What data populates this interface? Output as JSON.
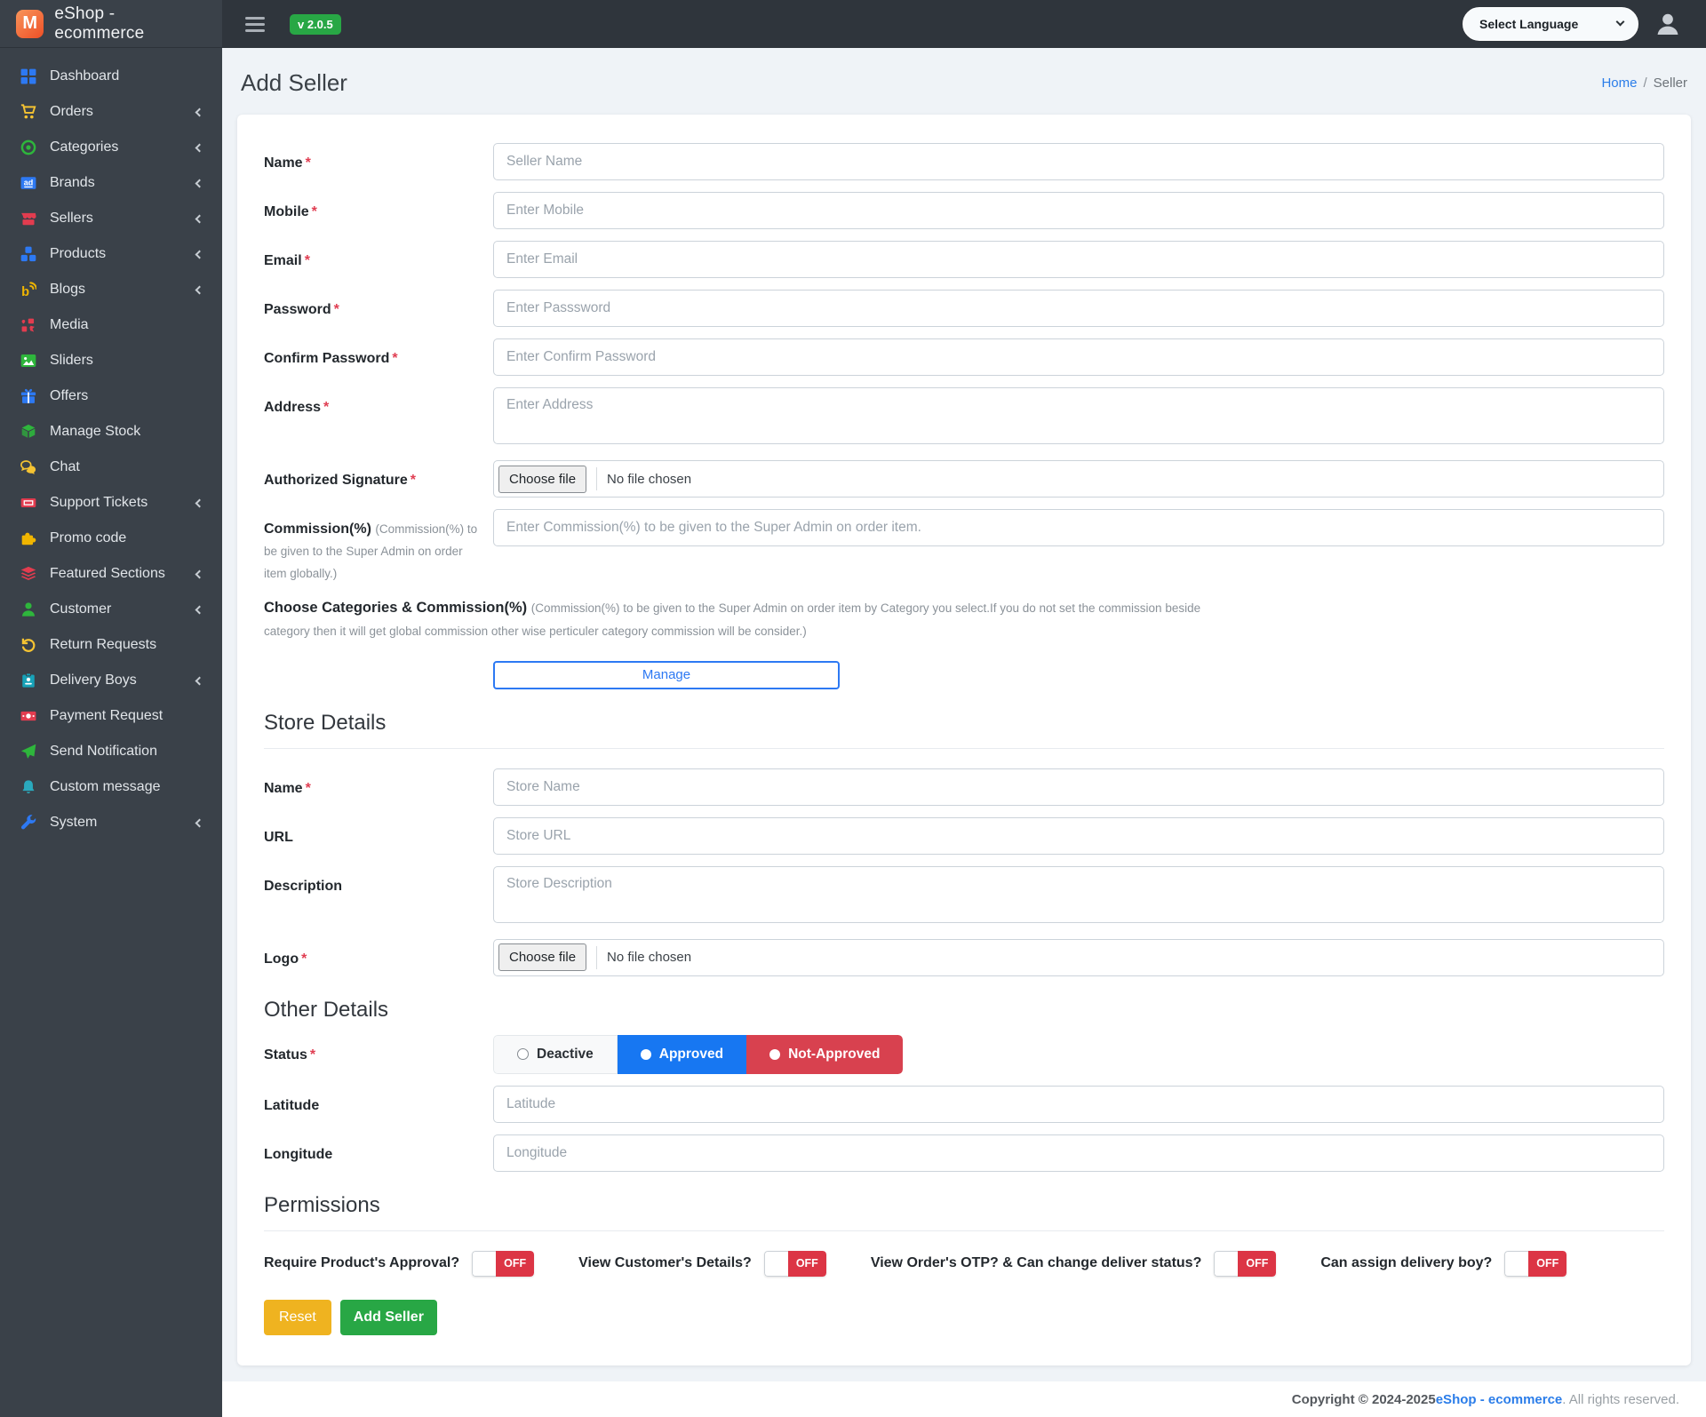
{
  "brand": {
    "logo_letter": "M",
    "title": "eShop - ecommerce",
    "version_badge": "v 2.0.5"
  },
  "navbar": {
    "language_select": "Select Language"
  },
  "sidebar": {
    "items": [
      {
        "label": "Dashboard",
        "icon": "dashboard-grid",
        "has_submenu": false
      },
      {
        "label": "Orders",
        "icon": "cart",
        "has_submenu": true
      },
      {
        "label": "Categories",
        "icon": "target",
        "has_submenu": true
      },
      {
        "label": "Brands",
        "icon": "ad-badge",
        "has_submenu": true
      },
      {
        "label": "Sellers",
        "icon": "storefront",
        "has_submenu": true
      },
      {
        "label": "Products",
        "icon": "cubes",
        "has_submenu": true
      },
      {
        "label": "Blogs",
        "icon": "blog",
        "has_submenu": true
      },
      {
        "label": "Media",
        "icon": "media-cluster",
        "has_submenu": false
      },
      {
        "label": "Sliders",
        "icon": "image",
        "has_submenu": false
      },
      {
        "label": "Offers",
        "icon": "gift",
        "has_submenu": false
      },
      {
        "label": "Manage Stock",
        "icon": "box-3d",
        "has_submenu": false
      },
      {
        "label": "Chat",
        "icon": "chat-bubbles",
        "has_submenu": false
      },
      {
        "label": "Support Tickets",
        "icon": "ticket",
        "has_submenu": true
      },
      {
        "label": "Promo code",
        "icon": "puzzle",
        "has_submenu": false
      },
      {
        "label": "Featured Sections",
        "icon": "layers",
        "has_submenu": true
      },
      {
        "label": "Customer",
        "icon": "person",
        "has_submenu": true
      },
      {
        "label": "Return Requests",
        "icon": "undo-arrow",
        "has_submenu": false
      },
      {
        "label": "Delivery Boys",
        "icon": "id-card",
        "has_submenu": true
      },
      {
        "label": "Payment Request",
        "icon": "banknote",
        "has_submenu": false
      },
      {
        "label": "Send Notification",
        "icon": "paper-plane",
        "has_submenu": false
      },
      {
        "label": "Custom message",
        "icon": "bell",
        "has_submenu": false
      },
      {
        "label": "System",
        "icon": "wrench",
        "has_submenu": true
      }
    ]
  },
  "page": {
    "title": "Add Seller",
    "breadcrumb": {
      "home": "Home",
      "separator": "/",
      "current": "Seller"
    }
  },
  "form": {
    "required_marker": "*",
    "name": {
      "label": "Name",
      "placeholder": "Seller Name"
    },
    "mobile": {
      "label": "Mobile",
      "placeholder": "Enter Mobile"
    },
    "email": {
      "label": "Email",
      "placeholder": "Enter Email"
    },
    "password": {
      "label": "Password",
      "placeholder": "Enter Passsword"
    },
    "confirm_password": {
      "label": "Confirm Password",
      "placeholder": "Enter Confirm Password"
    },
    "address": {
      "label": "Address",
      "placeholder": "Enter Address"
    },
    "authorized_signature": {
      "label": "Authorized Signature",
      "choose_file": "Choose file",
      "no_file": "No file chosen"
    },
    "commission": {
      "label": "Commission(%)",
      "note": "(Commission(%) to be given to the Super Admin on order item globally.)",
      "placeholder": "Enter Commission(%) to be given to the Super Admin on order item."
    },
    "choose_categories": {
      "label": "Choose Categories & Commission(%)",
      "note": "(Commission(%) to be given to the Super Admin on order item by Category you select.If you do not set the commission beside category then it will get global commission other wise perticuler category commission will be consider.)",
      "manage": "Manage"
    }
  },
  "store_details": {
    "heading": "Store Details",
    "name": {
      "label": "Name",
      "placeholder": "Store Name"
    },
    "url": {
      "label": "URL",
      "placeholder": "Store URL"
    },
    "description": {
      "label": "Description",
      "placeholder": "Store Description"
    },
    "logo": {
      "label": "Logo",
      "choose_file": "Choose file",
      "no_file": "No file chosen"
    }
  },
  "other_details": {
    "heading": "Other Details",
    "status": {
      "label": "Status",
      "options": [
        {
          "label": "Deactive",
          "selected": false
        },
        {
          "label": "Approved",
          "selected": true
        },
        {
          "label": "Not-Approved",
          "selected": false
        }
      ]
    },
    "latitude": {
      "label": "Latitude",
      "placeholder": "Latitude"
    },
    "longitude": {
      "label": "Longitude",
      "placeholder": "Longitude"
    }
  },
  "permissions": {
    "heading": "Permissions",
    "toggles": [
      {
        "label": "Require Product's Approval?",
        "state": "OFF"
      },
      {
        "label": "View Customer's Details?",
        "state": "OFF"
      },
      {
        "label": "View Order's OTP? & Can change deliver status?",
        "state": "OFF"
      },
      {
        "label": "Can assign delivery boy?",
        "state": "OFF"
      }
    ]
  },
  "actions": {
    "reset": "Reset",
    "submit": "Add Seller"
  },
  "footer": {
    "copyright": "Copyright © 2024-2025 ",
    "brand": "eShop - ecommerce",
    "suffix": ". All rights reserved."
  },
  "colors": {
    "sidebar_bg": "#3a4149",
    "topbar_bg": "#2f353c",
    "accent_blue": "#2d79f3",
    "approved_blue": "#1777f2",
    "danger_red": "#dc3545",
    "badge_green": "#28a745",
    "reset_yellow": "#efb320",
    "logo_orange": "#ee4f26"
  }
}
